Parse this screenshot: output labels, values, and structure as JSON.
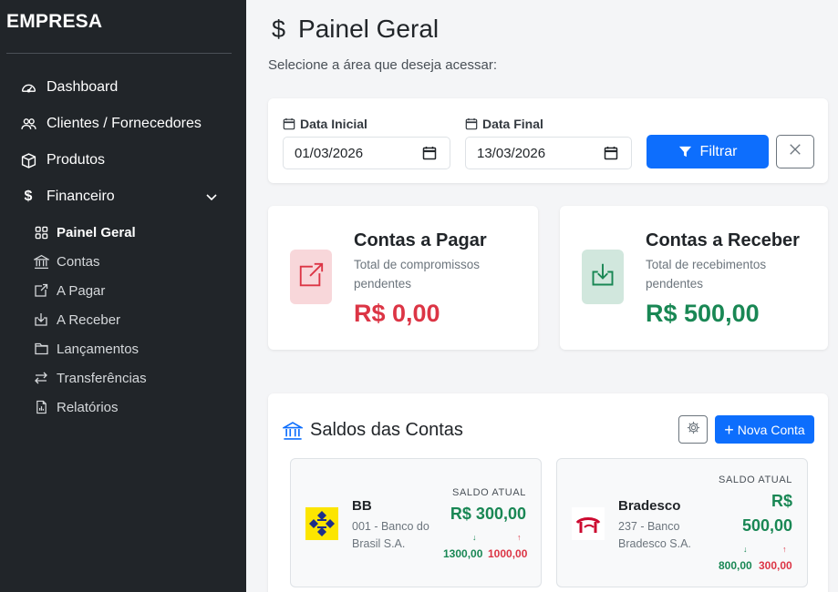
{
  "sidebar": {
    "brand": "EMPRESA",
    "items": [
      {
        "label": "Dashboard",
        "icon": "speedometer-icon"
      },
      {
        "label": "Clientes / Fornecedores",
        "icon": "people-icon"
      },
      {
        "label": "Produtos",
        "icon": "box-icon"
      },
      {
        "label": "Financeiro",
        "icon": "dollar-icon"
      }
    ],
    "financeiro_sub": [
      {
        "label": "Painel Geral",
        "icon": "grid-icon",
        "active": true
      },
      {
        "label": "Contas",
        "icon": "bank-icon"
      },
      {
        "label": "A Pagar",
        "icon": "box-arrow-up-right-icon"
      },
      {
        "label": "A Receber",
        "icon": "box-arrow-in-down-icon"
      },
      {
        "label": "Lançamentos",
        "icon": "folder-icon"
      },
      {
        "label": "Transferências",
        "icon": "arrow-left-right-icon"
      },
      {
        "label": "Relatórios",
        "icon": "file-bar-graph-icon"
      }
    ]
  },
  "header": {
    "title": "Painel Geral",
    "title_symbol": "$",
    "subtitle": "Selecione a área que deseja acessar:"
  },
  "filter": {
    "start_label": "Data Inicial",
    "start_value": "01/03/2026",
    "end_label": "Data Final",
    "end_value": "13/03/2026",
    "filter_button": "Filtrar"
  },
  "summary": {
    "pagar": {
      "title": "Contas a Pagar",
      "desc": "Total de compromissos pendentes",
      "value": "R$ 0,00",
      "color": "#dc3545"
    },
    "receber": {
      "title": "Contas a Receber",
      "desc": "Total de recebimentos pendentes",
      "value": "R$ 500,00",
      "color": "#198754"
    }
  },
  "saldos": {
    "title": "Saldos das Contas",
    "new_button": "Nova Conta",
    "saldo_label": "SALDO ATUAL",
    "accounts": [
      {
        "name": "BB",
        "desc": "001 - Banco do Brasil S.A.",
        "balance": "R$ 300,00",
        "in": "1300,00",
        "out": "1000,00"
      },
      {
        "name": "Bradesco",
        "desc": "237 - Banco Bradesco S.A.",
        "balance_line1": "R$",
        "balance_line2": "500,00",
        "in": "800,00",
        "out": "300,00"
      }
    ]
  },
  "colors": {
    "accent": "#0d6efd",
    "success": "#198754",
    "danger": "#dc3545",
    "sidebar": "#212529"
  }
}
